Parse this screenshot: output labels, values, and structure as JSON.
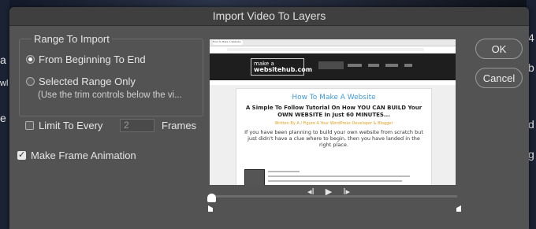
{
  "background": {
    "left_fragments": [
      "a",
      "wl",
      "e"
    ],
    "right_fragments": [
      "4",
      "b",
      "d",
      "g"
    ]
  },
  "dialog": {
    "title": "Import Video To Layers",
    "range_group_title": "Range To Import",
    "options": [
      {
        "label": "From Beginning To End",
        "selected": true
      },
      {
        "label": "Selected Range Only",
        "selected": false
      }
    ],
    "range_hint": "(Use the trim controls below the vi...",
    "limit": {
      "label": "Limit To Every",
      "checked": false,
      "value": "2",
      "unit_label": "Frames"
    },
    "frame_animation": {
      "label": "Make Frame Animation",
      "checked": true
    },
    "buttons": {
      "ok": "OK",
      "cancel": "Cancel"
    },
    "playback": {
      "prev": "◂I",
      "play": "▶",
      "next": "I▸"
    },
    "colors": {
      "dialog_bg": "#535353",
      "title_bg": "#3f3f3f",
      "accent_link": "#3f9ad6"
    }
  },
  "preview": {
    "tab_text": "How To Make A Website",
    "logo_line1": "make a",
    "logo_line2": "websitehub.com",
    "heading": "How To Make A Website",
    "subheading": "A Simple To Follow Tutorial On How YOU CAN BUILD Your OWN WEBSITE In Just 60 MINUTES...",
    "author": "Written By A / Figure A Your WordPress Developer & Blogger",
    "paragraph": "If you have been planning to build your own website from scratch but just didn't have a clue where to begin, then you have landed in the right place."
  }
}
